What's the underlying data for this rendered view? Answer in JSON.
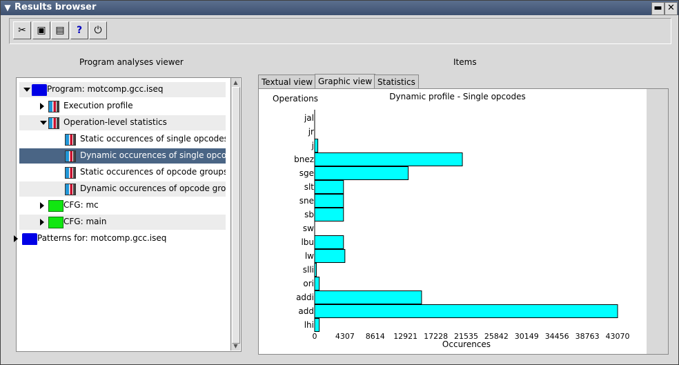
{
  "window": {
    "title": "Results browser",
    "minimize_label": "▬",
    "close_label": "✕",
    "menu_label": "▼"
  },
  "toolbar": {
    "buttons": [
      {
        "icon": "tools-icon",
        "glyph": "✂"
      },
      {
        "icon": "document-icon",
        "glyph": "▣"
      },
      {
        "icon": "save-icon",
        "glyph": "▤"
      },
      {
        "icon": "help-icon",
        "glyph": "?"
      },
      {
        "icon": "power-icon",
        "glyph": "⏻"
      }
    ]
  },
  "left_panel": {
    "title": "Program analyses viewer"
  },
  "right_panel": {
    "title": "Items"
  },
  "tree": {
    "items": [
      {
        "label": "Program: motcomp.gcc.iseq",
        "depth": 0,
        "state": "expanded",
        "icon": "blue-folder-icon"
      },
      {
        "label": "Execution profile",
        "depth": 1,
        "state": "collapsed",
        "icon": "chart-folder-icon"
      },
      {
        "label": "Operation-level statistics",
        "depth": 1,
        "state": "expanded",
        "icon": "chart-folder-icon"
      },
      {
        "label": "Static occurences of single opcodes",
        "depth": 2,
        "state": "leaf",
        "icon": "bar-chart-icon"
      },
      {
        "label": "Dynamic occurences of single opcodes",
        "depth": 2,
        "state": "leaf",
        "icon": "bar-chart-icon",
        "selected": true
      },
      {
        "label": "Static occurences of opcode groups",
        "depth": 2,
        "state": "leaf",
        "icon": "bar-chart-icon"
      },
      {
        "label": "Dynamic occurences of opcode groups",
        "depth": 2,
        "state": "leaf",
        "icon": "bar-chart-icon"
      },
      {
        "label": "CFG: mc",
        "depth": 1,
        "state": "collapsed",
        "icon": "green-folder-icon"
      },
      {
        "label": "CFG: main",
        "depth": 1,
        "state": "collapsed",
        "icon": "green-folder-icon"
      },
      {
        "label": "Patterns for: motcomp.gcc.iseq",
        "depth": -1,
        "state": "collapsed",
        "icon": "blue-folder-icon"
      }
    ]
  },
  "tabs": [
    {
      "label": "Textual view",
      "active": false
    },
    {
      "label": "Graphic view",
      "active": true
    },
    {
      "label": "Statistics",
      "active": false
    }
  ],
  "chart_data": {
    "type": "bar",
    "orientation": "horizontal",
    "title": "Dynamic profile - Single opcodes",
    "ylabel": "Operations",
    "xlabel": "Occurences",
    "categories": [
      "jal",
      "jr",
      "j",
      "bnez",
      "sge",
      "slt",
      "sne",
      "sb",
      "sw",
      "lbu",
      "lw",
      "slli",
      "ori",
      "addi",
      "add",
      "lhi"
    ],
    "values": [
      0,
      0,
      450,
      21000,
      13300,
      4100,
      4100,
      4100,
      0,
      4100,
      4300,
      250,
      650,
      15200,
      43070,
      650
    ],
    "xlim": [
      0,
      43070
    ],
    "xticks": [
      "0",
      "4307",
      "8614",
      "12921",
      "17228",
      "21535",
      "25842",
      "30149",
      "34456",
      "38763",
      "43070"
    ],
    "bar_color": "#00ffff",
    "grid": false
  }
}
